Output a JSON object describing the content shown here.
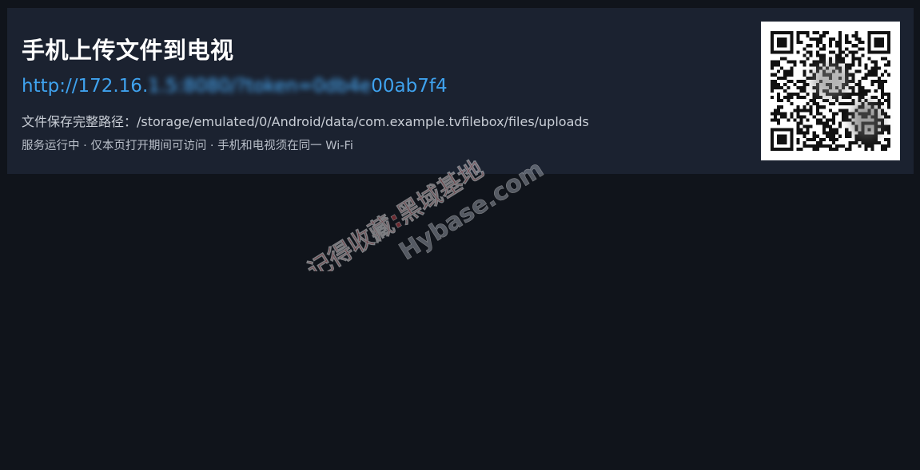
{
  "panel": {
    "title": "手机上传文件到电视",
    "url": {
      "prefix": "http://172.16.",
      "blurred": "1.5:8080/?token=0db4e",
      "suffix": "00ab7f4"
    },
    "save_path": {
      "label": "文件保存完整路径：",
      "value": "/storage/emulated/0/Android/data/com.example.tvfilebox/files/uploads"
    },
    "status": "服务运行中 · 仅本页打开期间可访问 · 手机和电视须在同一 Wi-Fi"
  },
  "qr_code": {
    "icon": "qr-code-icon",
    "foreground": "#111111",
    "background": "#ffffff"
  },
  "watermark": {
    "line1": "记得收藏:黑域基地",
    "line2": "Hybase.com",
    "color": "#d9434a"
  },
  "colors": {
    "background": "#10141b",
    "panel": "#1b2230",
    "link": "#3fa2ee",
    "title": "#ffffff"
  }
}
